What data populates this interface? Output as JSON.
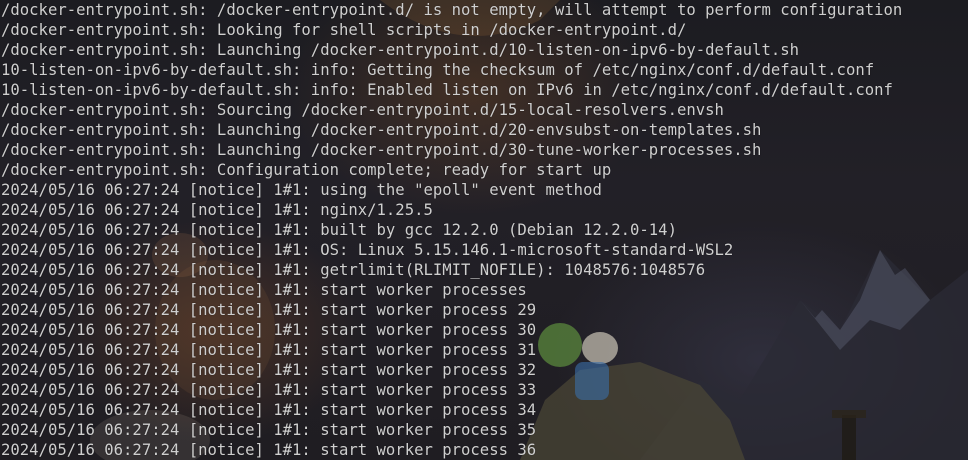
{
  "terminal": {
    "lines": [
      "/docker-entrypoint.sh: /docker-entrypoint.d/ is not empty, will attempt to perform configuration",
      "/docker-entrypoint.sh: Looking for shell scripts in /docker-entrypoint.d/",
      "/docker-entrypoint.sh: Launching /docker-entrypoint.d/10-listen-on-ipv6-by-default.sh",
      "10-listen-on-ipv6-by-default.sh: info: Getting the checksum of /etc/nginx/conf.d/default.conf",
      "10-listen-on-ipv6-by-default.sh: info: Enabled listen on IPv6 in /etc/nginx/conf.d/default.conf",
      "/docker-entrypoint.sh: Sourcing /docker-entrypoint.d/15-local-resolvers.envsh",
      "/docker-entrypoint.sh: Launching /docker-entrypoint.d/20-envsubst-on-templates.sh",
      "/docker-entrypoint.sh: Launching /docker-entrypoint.d/30-tune-worker-processes.sh",
      "/docker-entrypoint.sh: Configuration complete; ready for start up",
      "2024/05/16 06:27:24 [notice] 1#1: using the \"epoll\" event method",
      "2024/05/16 06:27:24 [notice] 1#1: nginx/1.25.5",
      "2024/05/16 06:27:24 [notice] 1#1: built by gcc 12.2.0 (Debian 12.2.0-14)",
      "2024/05/16 06:27:24 [notice] 1#1: OS: Linux 5.15.146.1-microsoft-standard-WSL2",
      "2024/05/16 06:27:24 [notice] 1#1: getrlimit(RLIMIT_NOFILE): 1048576:1048576",
      "2024/05/16 06:27:24 [notice] 1#1: start worker processes",
      "2024/05/16 06:27:24 [notice] 1#1: start worker process 29",
      "2024/05/16 06:27:24 [notice] 1#1: start worker process 30",
      "2024/05/16 06:27:24 [notice] 1#1: start worker process 31",
      "2024/05/16 06:27:24 [notice] 1#1: start worker process 32",
      "2024/05/16 06:27:24 [notice] 1#1: start worker process 33",
      "2024/05/16 06:27:24 [notice] 1#1: start worker process 34",
      "2024/05/16 06:27:24 [notice] 1#1: start worker process 35",
      "2024/05/16 06:27:24 [notice] 1#1: start worker process 36"
    ],
    "colors": {
      "text": "#cfcfcf",
      "background": "#1c1c21"
    }
  }
}
